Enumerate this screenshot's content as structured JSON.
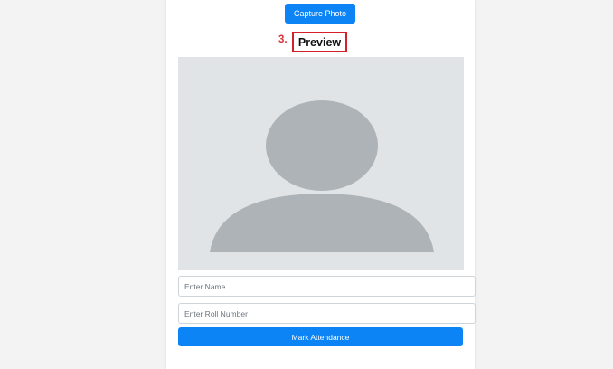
{
  "capture": {
    "label": "Capture Photo"
  },
  "preview": {
    "step_number": "3.",
    "title": "Preview"
  },
  "photo": {
    "icon": "person-placeholder-icon"
  },
  "form": {
    "name_placeholder": "Enter Name",
    "name_value": "",
    "roll_placeholder": "Enter Roll Number",
    "roll_value": "",
    "submit_label": "Mark Attendance"
  },
  "colors": {
    "accent": "#0d84f6",
    "highlight_border": "#d3202b",
    "step_number": "#d9323a",
    "placeholder_bg": "#e1e4e6",
    "placeholder_fg": "#adb3b7"
  }
}
